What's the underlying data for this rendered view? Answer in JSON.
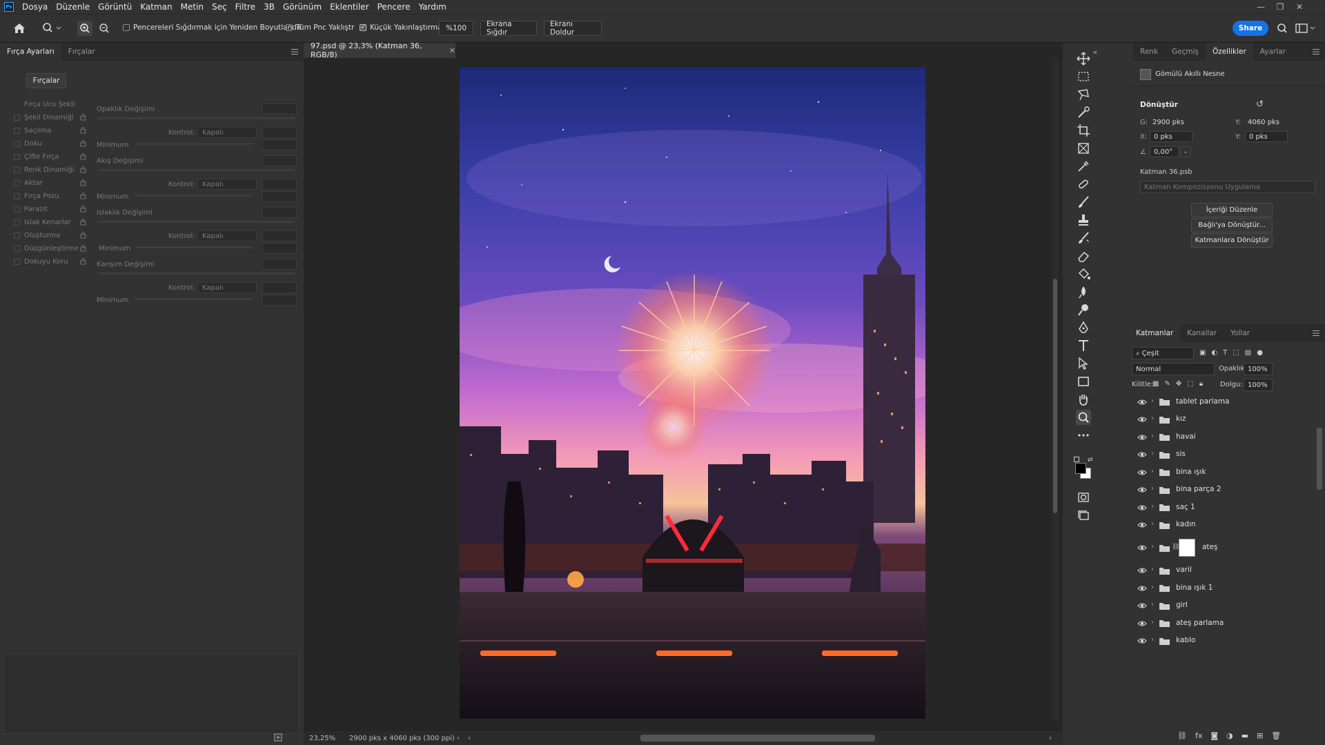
{
  "menubar": {
    "logo": "Ps",
    "items": [
      "Dosya",
      "Düzenle",
      "Görüntü",
      "Katman",
      "Metin",
      "Seç",
      "Filtre",
      "3B",
      "Görünüm",
      "Eklentiler",
      "Pencere",
      "Yardım"
    ]
  },
  "options": {
    "resize_windows": "Pencereleri Sığdırmak için Yeniden Boyutlandır",
    "zoom_all": "Tüm Pnc Yaklıştr",
    "scrubby_zoom": "Küçük Yakınlaştırma",
    "zoom_100": "%100",
    "fit_screen": "Ekrana Sığdır",
    "fill_screen": "Ekranı Doldur",
    "share": "Share",
    "accent_color": "#1473e6"
  },
  "left_panel": {
    "tabs": [
      "Fırça Ayarları",
      "Fırçalar"
    ],
    "brushes_button": "Fırçalar",
    "tip_shape": "Fırça Ucu Şekli",
    "options": [
      "Şekil Dinamiği",
      "Saçılma",
      "Doku",
      "Çifte Fırça",
      "Renk Dinamiği",
      "Aktar",
      "Fırça Pozu",
      "Parazit",
      "Islak Kenarlar",
      "Oluşturma",
      "Düzgünleştirme",
      "Dokuyu Koru"
    ],
    "sections": {
      "opacity_jitter": "Opaklık Değişimi",
      "flow_jitter": "Akış Değişimi",
      "wetness_jitter": "Islaklık Değişimi",
      "mix_jitter": "Karışım Değişimi",
      "control": "Kontrol:",
      "off": "Kapalı",
      "minimum": "Minimum"
    }
  },
  "document": {
    "tab_title": "97.psd @ 23,3% (Katman 36, RGB/8)",
    "zoom": "23,25%",
    "doc_size": "2900 pks x 4060 pks (300 ppi)"
  },
  "right_panel": {
    "tabs": [
      "Renk",
      "Geçmiş",
      "Özellikler",
      "Ayarlar"
    ],
    "smart_object": "Gömülü Akıllı Nesne",
    "transform": "Dönüştür",
    "w_label": "G:",
    "w_value": "2900 pks",
    "h_label": "Y:",
    "h_value": "4060 pks",
    "x_label": "X:",
    "x_value": "0 pks",
    "y_label": "Y:",
    "y_value": "0 pks",
    "angle": "0,00°",
    "file_name": "Katman 36.psb",
    "comp_placeholder": "Katman Kompozisyonu Uygulama",
    "btn_edit": "İçeriği Düzenle",
    "btn_convert_linked": "Bağlı'ya Dönüştür...",
    "btn_convert_layers": "Katmanlara Dönüştür"
  },
  "layers_panel": {
    "tabs": [
      "Katmanlar",
      "Kanallar",
      "Yollar"
    ],
    "filter": "Çeşit",
    "blend_mode": "Normal",
    "opacity_label": "Opaklık:",
    "opacity": "100%",
    "lock_label": "Kilitle:",
    "fill_label": "Dolgu:",
    "fill": "100%",
    "layers": [
      "tablet parlama",
      "kız",
      "havai",
      "sis",
      "bina ışık",
      "bina parça 2",
      "saç 1",
      "kadın",
      "ateş",
      "varil",
      "bina ışık 1",
      "girl",
      "ateş parlama",
      "kablo"
    ]
  }
}
